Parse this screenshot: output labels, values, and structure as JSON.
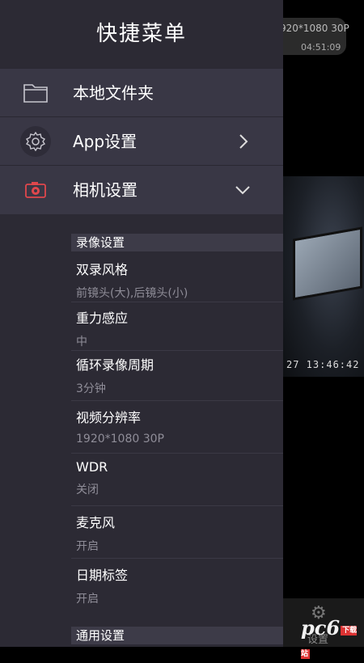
{
  "background": {
    "resolution": "920*1080 30P",
    "time": "04:51:09",
    "preview_timestamp": "27 13:46:42",
    "bottom_setting_label": "设置",
    "watermark": "pc6",
    "watermark_badge": "下载站"
  },
  "drawer": {
    "title": "快捷菜单",
    "nav": [
      {
        "label": "本地文件夹",
        "icon": "folder-icon"
      },
      {
        "label": "App设置",
        "icon": "gear-icon",
        "chevron": "›"
      },
      {
        "label": "相机设置",
        "icon": "camera-icon",
        "chevron": "⌄"
      }
    ],
    "sections": [
      {
        "title": "录像设置",
        "settings": [
          {
            "name": "双录风格",
            "value": "前镜头(大),后镜头(小)"
          },
          {
            "name": "重力感应",
            "value": "中"
          },
          {
            "name": "循环录像周期",
            "value": "3分钟"
          },
          {
            "name": "视频分辨率",
            "value": "1920*1080 30P"
          },
          {
            "name": "WDR",
            "value": "关闭"
          },
          {
            "name": "麦克风",
            "value": "开启"
          },
          {
            "name": "日期标签",
            "value": "开启"
          }
        ]
      },
      {
        "title": "通用设置"
      }
    ]
  },
  "colors": {
    "drawer_bg": "#2c2a34",
    "nav_bg": "#393745",
    "camera_icon": "#e0474c"
  }
}
